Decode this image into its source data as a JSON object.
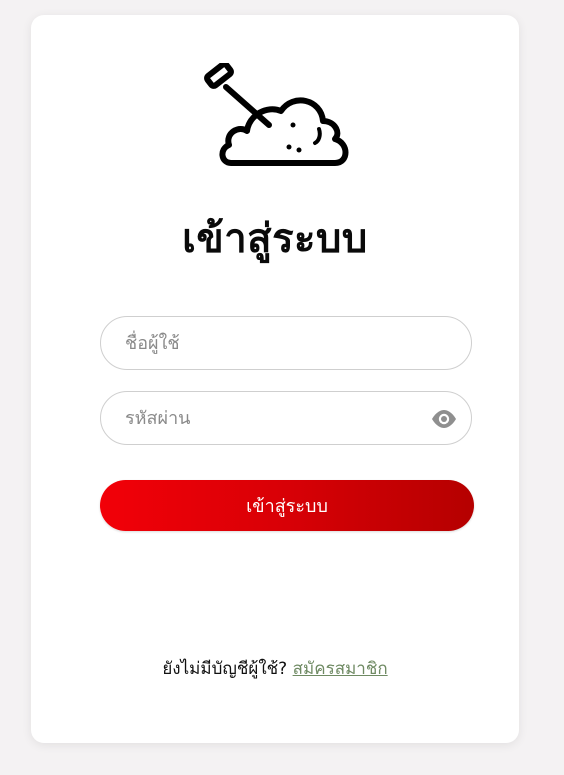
{
  "logo": {
    "icon": "shovel-soil-icon"
  },
  "title": "เข้าสู่ระบบ",
  "username": {
    "placeholder": "ชื่อผู้ใช้",
    "value": ""
  },
  "password": {
    "placeholder": "รหัสผ่าน",
    "value": "",
    "toggle_icon": "eye-icon"
  },
  "login_button": {
    "label": "เข้าสู่ระบบ"
  },
  "footer": {
    "prompt": "ยังไม่มีบัญชีผู้ใช้? ",
    "register_link": "สมัครสมาชิก"
  },
  "colors": {
    "button_start": "#f20008",
    "button_end": "#b50000",
    "link": "#6f8a63",
    "background": "#f4f2f3"
  }
}
